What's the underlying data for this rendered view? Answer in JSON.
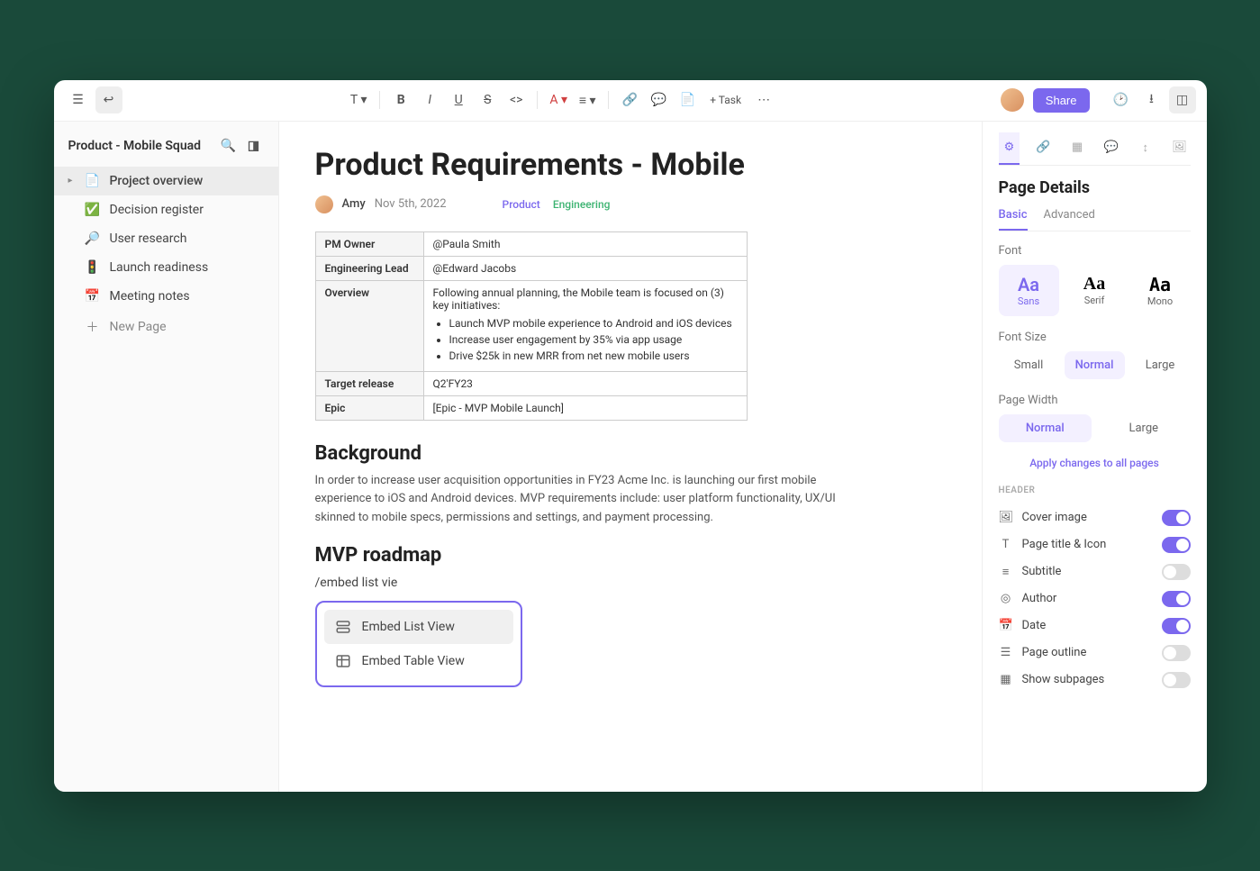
{
  "topbar": {
    "task_label": "+ Task",
    "share_label": "Share"
  },
  "sidebar": {
    "title": "Product - Mobile Squad",
    "items": [
      {
        "icon": "📄",
        "label": "Project overview",
        "active": true,
        "caret": true
      },
      {
        "icon": "✅",
        "label": "Decision register"
      },
      {
        "icon": "🔎",
        "label": "User research"
      },
      {
        "icon": "🚦",
        "label": "Launch readiness"
      },
      {
        "icon": "📅",
        "label": "Meeting notes"
      }
    ],
    "new_page_label": "New Page"
  },
  "page": {
    "title": "Product Requirements - Mobile",
    "author": "Amy",
    "date": "Nov 5th, 2022",
    "tags": {
      "product": "Product",
      "engineering": "Engineering"
    },
    "table": {
      "pm_owner_label": "PM Owner",
      "pm_owner_value": "@Paula Smith",
      "eng_lead_label": "Engineering Lead",
      "eng_lead_value": "@Edward Jacobs",
      "overview_label": "Overview",
      "overview_intro": "Following annual planning, the Mobile team is focused on (3) key initiatives:",
      "overview_items": [
        "Launch MVP mobile experience to Android and iOS devices",
        "Increase user engagement by 35% via app usage",
        "Drive $25k in new MRR from net new mobile users"
      ],
      "target_release_label": "Target release",
      "target_release_value": "Q2'FY23",
      "epic_label": "Epic",
      "epic_value": "[Epic - MVP Mobile Launch]"
    },
    "background_heading": "Background",
    "background_text": "In order to increase user acquisition opportunities in FY23 Acme Inc. is launching our first mobile experience to iOS and Android devices. MVP requirements include: user platform functionality, UX/UI skinned to mobile specs, permissions and settings, and payment processing.",
    "roadmap_heading": "MVP roadmap",
    "slash_command": "/embed list vie",
    "embed_menu": {
      "list": "Embed List View",
      "table": "Embed Table View"
    }
  },
  "rightpanel": {
    "title": "Page Details",
    "subtabs": {
      "basic": "Basic",
      "advanced": "Advanced"
    },
    "font_label": "Font",
    "fonts": {
      "sans": "Sans",
      "serif": "Serif",
      "mono": "Mono"
    },
    "font_size_label": "Font Size",
    "font_sizes": {
      "small": "Small",
      "normal": "Normal",
      "large": "Large"
    },
    "page_width_label": "Page Width",
    "page_widths": {
      "normal": "Normal",
      "large": "Large"
    },
    "apply_all_label": "Apply changes to all pages",
    "header_section": "HEADER",
    "toggles": [
      {
        "icon": "🖼",
        "label": "Cover image",
        "on": true
      },
      {
        "icon": "T",
        "label": "Page title & Icon",
        "on": true
      },
      {
        "icon": "≡",
        "label": "Subtitle",
        "on": false
      },
      {
        "icon": "◎",
        "label": "Author",
        "on": true
      },
      {
        "icon": "📅",
        "label": "Date",
        "on": true
      },
      {
        "icon": "☰",
        "label": "Page outline",
        "on": false
      },
      {
        "icon": "▦",
        "label": "Show subpages",
        "on": false
      }
    ]
  }
}
